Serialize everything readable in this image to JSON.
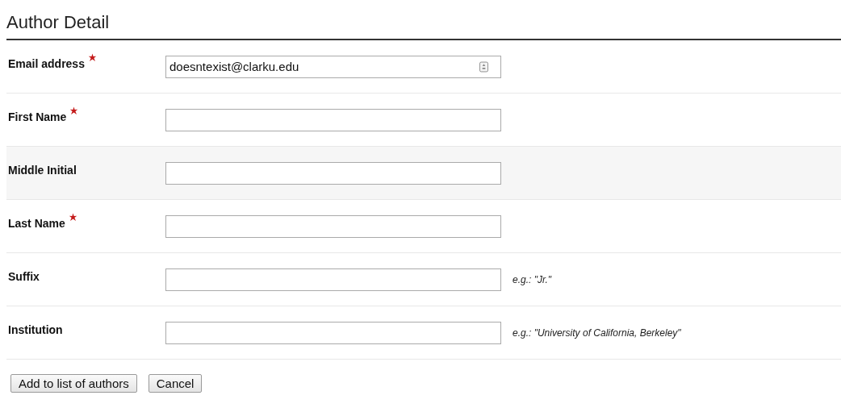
{
  "heading": "Author Detail",
  "fields": [
    {
      "label": "Email address",
      "required": true,
      "value": "doesntexist@clarku.edu",
      "highlighted": false,
      "autofill_icon": true
    },
    {
      "label": "First Name",
      "required": true,
      "highlighted": false
    },
    {
      "label": "Middle Initial",
      "required": false,
      "highlighted": true
    },
    {
      "label": "Last Name",
      "required": true,
      "highlighted": false
    },
    {
      "label": "Suffix",
      "required": false,
      "highlighted": false,
      "hint": "e.g.: \"Jr.\""
    },
    {
      "label": "Institution",
      "required": false,
      "highlighted": false,
      "hint": "e.g.: \"University of California, Berkeley\""
    }
  ],
  "buttons": [
    "Add to list of authors",
    "Cancel"
  ]
}
